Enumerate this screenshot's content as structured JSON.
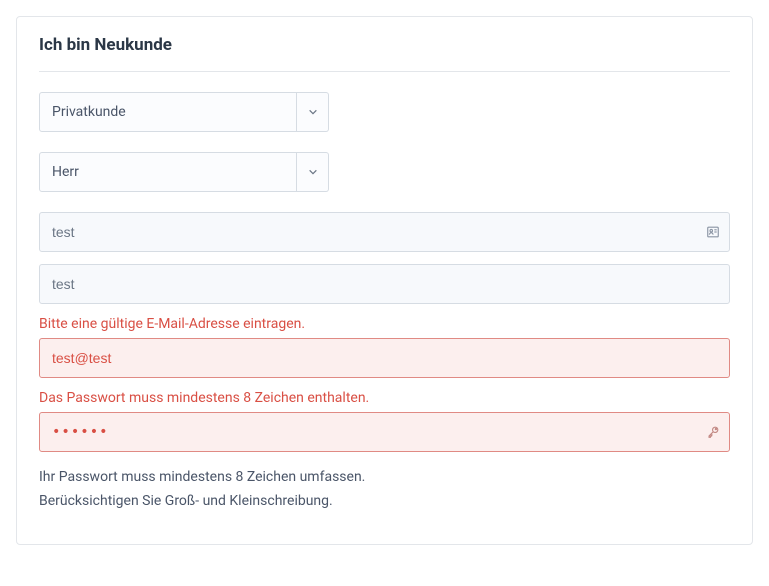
{
  "title": "Ich bin Neukunde",
  "customerType": {
    "value": "Privatkunde"
  },
  "salutation": {
    "value": "Herr"
  },
  "firstName": {
    "value": "test"
  },
  "lastName": {
    "value": "test"
  },
  "email": {
    "value": "test@test",
    "error": "Bitte eine gültige E-Mail-Adresse eintragen."
  },
  "password": {
    "masked": "••••••",
    "error": "Das Passwort muss mindestens 8 Zeichen enthalten."
  },
  "hint": {
    "line1": "Ihr Passwort muss mindestens 8 Zeichen umfassen.",
    "line2": "Berücksichtigen Sie Groß- und Kleinschreibung."
  }
}
